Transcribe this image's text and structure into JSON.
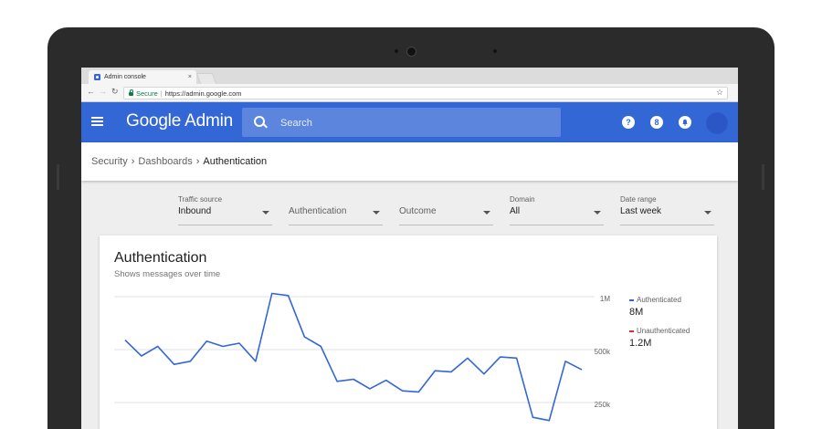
{
  "browser": {
    "tab_title": "Admin console",
    "tab_close": "×",
    "secure_label": "Secure",
    "url": "https://admin.google.com"
  },
  "header": {
    "logo": "Google Admin",
    "search_placeholder": "Search",
    "help_icon": "?",
    "apps_icon": "8",
    "notifications_icon": "🔔"
  },
  "breadcrumb": {
    "items": [
      "Security",
      "Dashboards",
      "Authentication"
    ]
  },
  "filters": [
    {
      "label": "Traffic source",
      "value": "Inbound"
    },
    {
      "label": "",
      "value": "Authentication"
    },
    {
      "label": "",
      "value": "Outcome"
    },
    {
      "label": "Domain",
      "value": "All"
    },
    {
      "label": "Date range",
      "value": "Last week"
    }
  ],
  "card": {
    "title": "Authentication",
    "subtitle": "Shows messages over time"
  },
  "legend": [
    {
      "name": "Authenticated",
      "value": "8M",
      "color": "#3367d6"
    },
    {
      "name": "Unauthenticated",
      "value": "1.2M",
      "color": "#d32f2f"
    }
  ],
  "chart_data": {
    "type": "line",
    "y_ticks": [
      "1M",
      "500k",
      "250k"
    ],
    "grid": true,
    "series": [
      {
        "name": "Authenticated",
        "color": "#3367d6",
        "values": [
          590,
          440,
          530,
          360,
          390,
          580,
          530,
          560,
          390,
          1030,
          1010,
          620,
          530,
          200,
          220,
          130,
          210,
          110,
          100,
          300,
          290,
          420,
          270,
          430,
          420,
          -140,
          -170,
          390,
          310
        ]
      }
    ]
  }
}
